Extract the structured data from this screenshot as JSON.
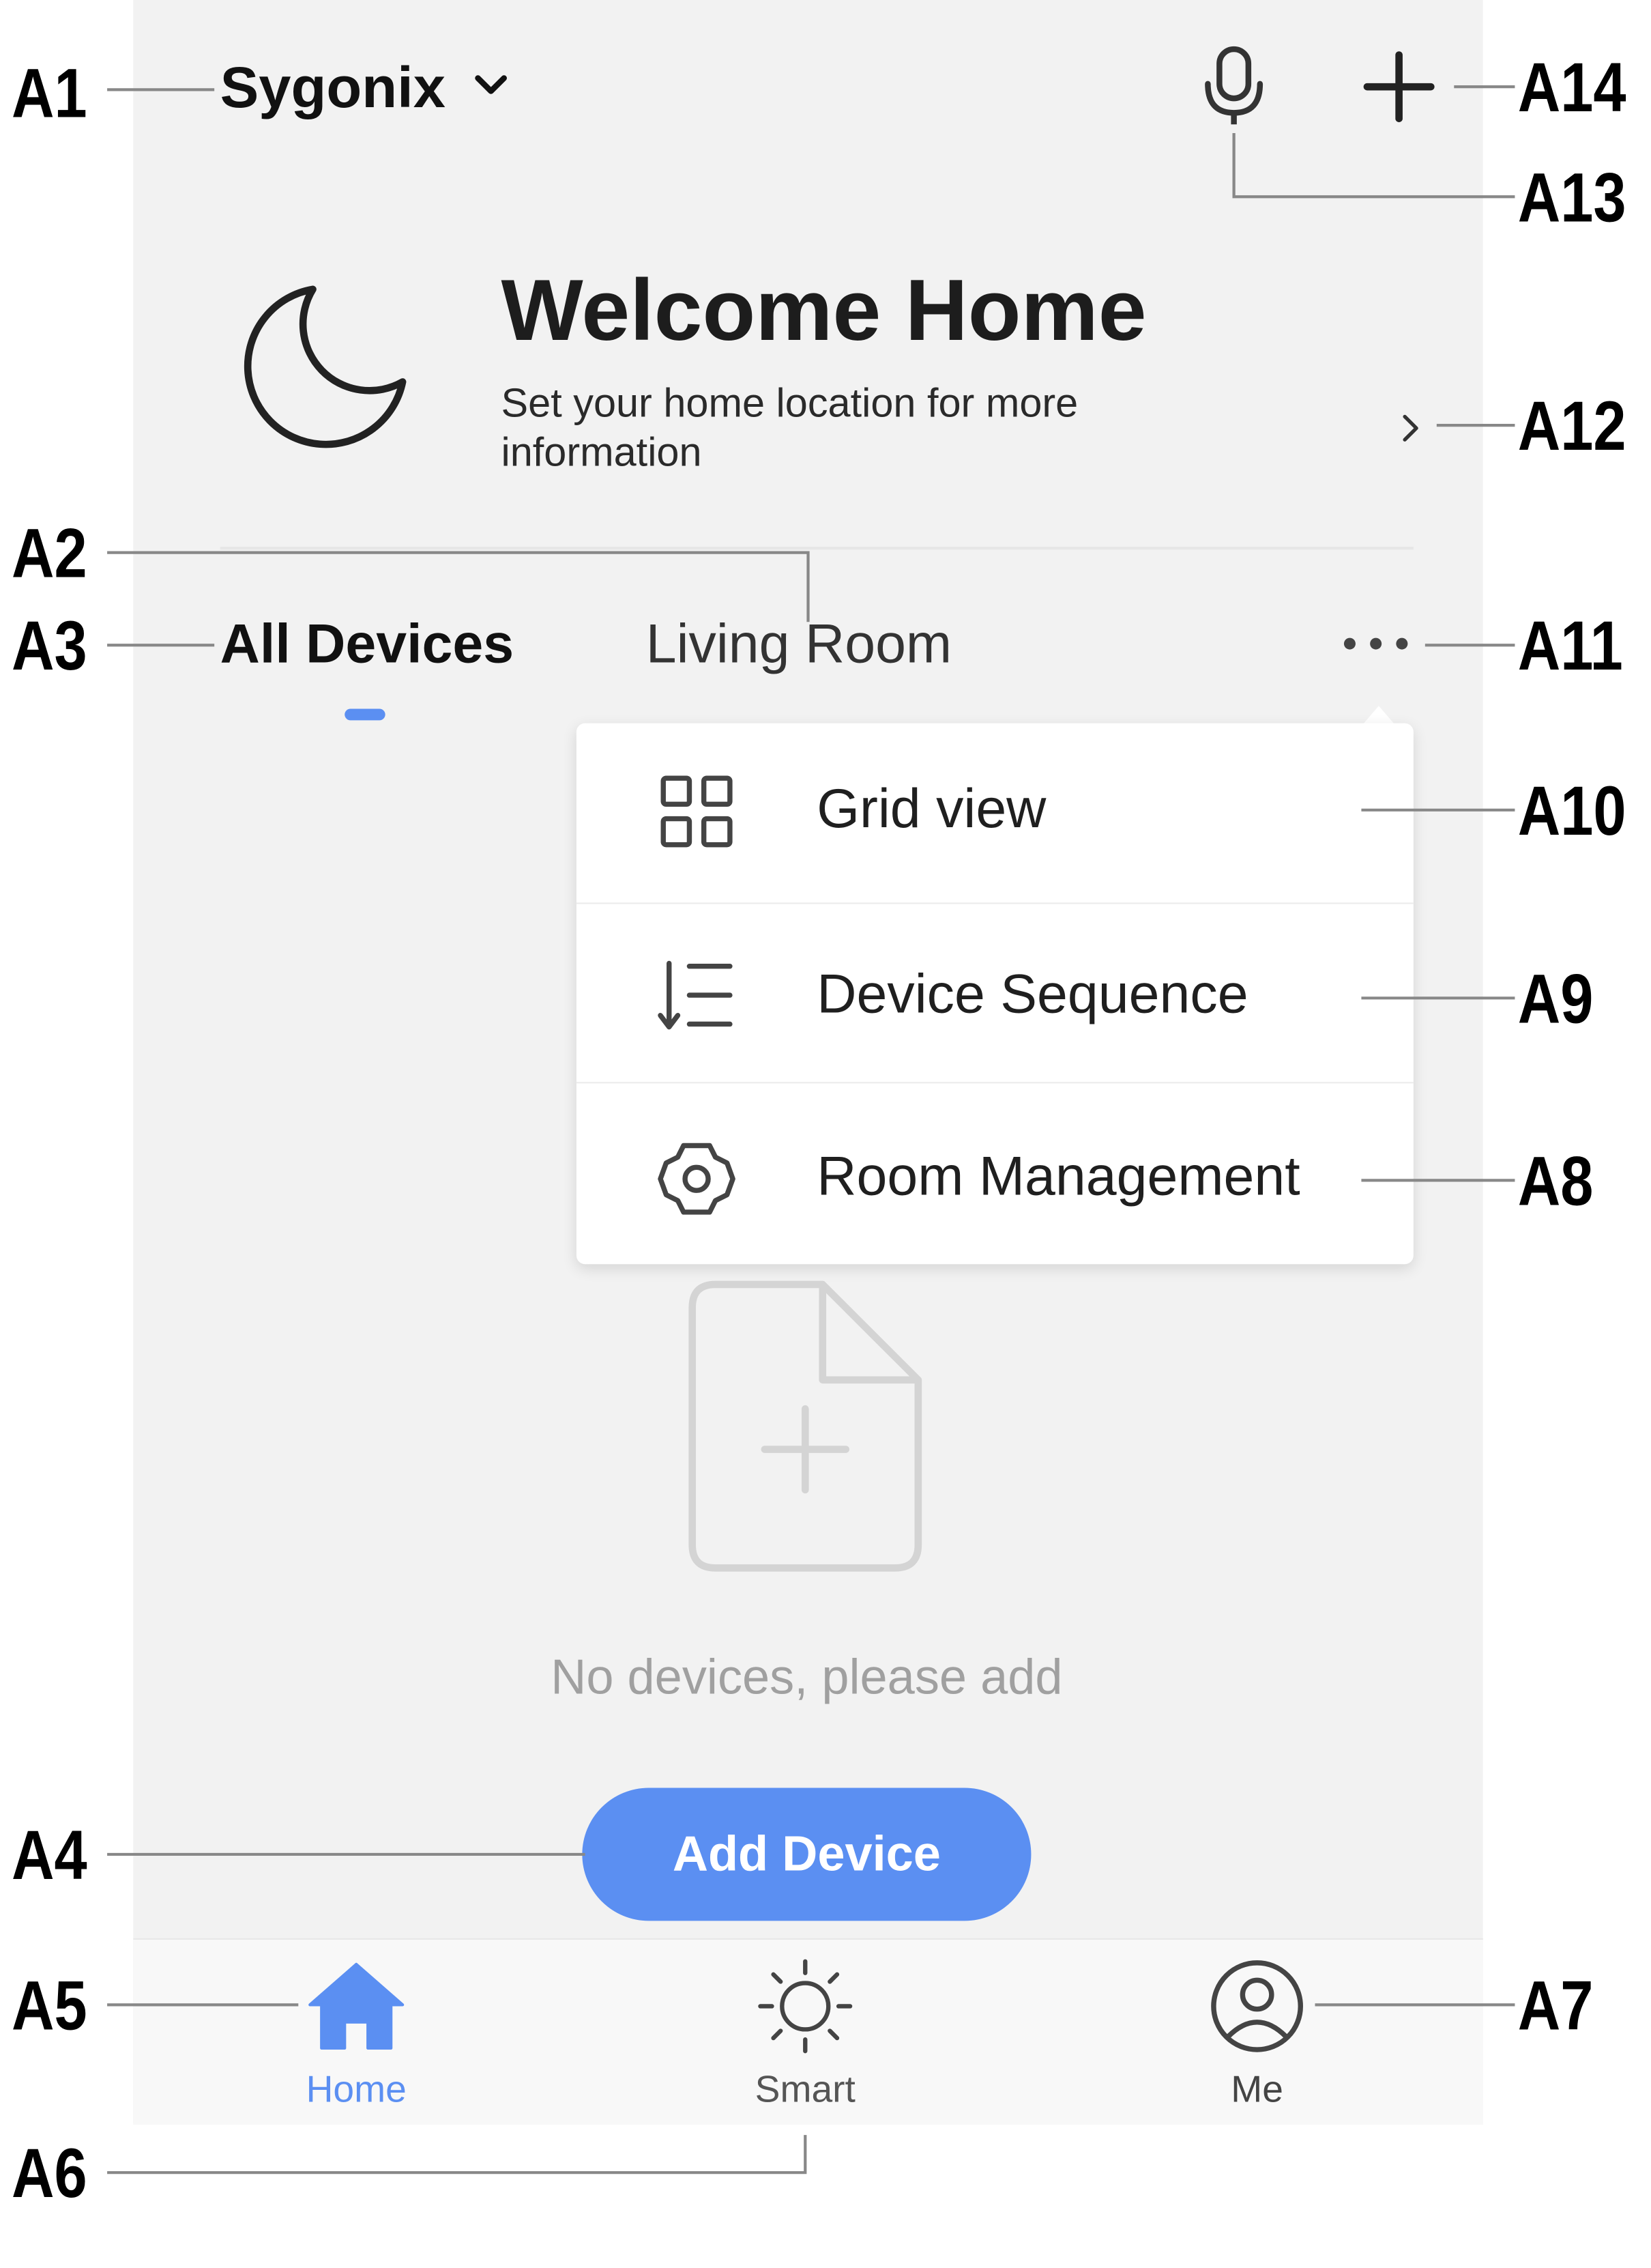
{
  "header": {
    "home_name": "Sygonix",
    "icons": [
      "chevron-down-icon",
      "microphone-icon",
      "plus-icon"
    ]
  },
  "welcome": {
    "title": "Welcome Home",
    "subtitle": "Set your home location for more information"
  },
  "tabs": [
    {
      "label": "All Devices",
      "active": true
    },
    {
      "label": "Living Room",
      "active": false
    }
  ],
  "menu": {
    "items": [
      {
        "label": "Grid view",
        "icon": "grid-icon"
      },
      {
        "label": "Device Sequence",
        "icon": "sort-list-icon"
      },
      {
        "label": "Room Management",
        "icon": "gear-icon"
      }
    ]
  },
  "empty_state": {
    "message": "No devices, please add",
    "button_label": "Add Device"
  },
  "bottom_nav": {
    "items": [
      {
        "label": "Home",
        "icon": "home-icon",
        "active": true
      },
      {
        "label": "Smart",
        "icon": "sun-icon",
        "active": false
      },
      {
        "label": "Me",
        "icon": "user-icon",
        "active": false
      }
    ]
  },
  "callouts": [
    "A1",
    "A2",
    "A3",
    "A4",
    "A5",
    "A6",
    "A7",
    "A8",
    "A9",
    "A10",
    "A11",
    "A12",
    "A13",
    "A14"
  ],
  "colors": {
    "accent": "#5b8ff2",
    "screen_background": "#f2f2f2",
    "text_primary": "#111111",
    "text_muted": "#a0a0a0"
  }
}
